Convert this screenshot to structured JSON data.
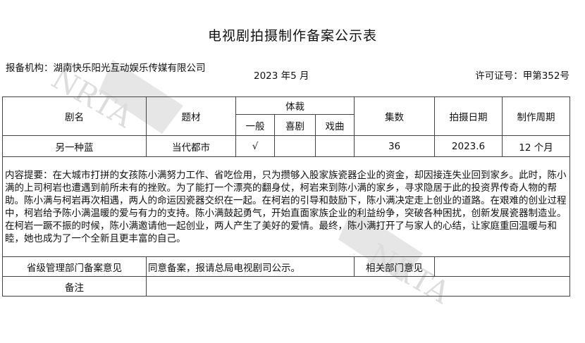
{
  "doc": {
    "title": "电视剧拍摄制作备案公示表",
    "org_label": "报备机构：",
    "org_name": "湖南快乐阳光互动娱乐传媒有限公司",
    "date": "2023 年5 月",
    "license_label": "许可证号：",
    "license_no": "甲第352号"
  },
  "table": {
    "headers": {
      "name": "剧名",
      "theme": "题材",
      "genre": "体裁",
      "genre_general": "一般",
      "genre_comedy": "喜剧",
      "genre_opera": "戏曲",
      "episodes": "集数",
      "shoot_date": "拍摄日期",
      "cycle": "制作周期"
    },
    "row": {
      "name": "另一种蓝",
      "theme": "当代都市",
      "general": "√",
      "comedy": "",
      "opera": "",
      "episodes": "36",
      "shoot_date": "2023.6",
      "cycle": "12 个月"
    },
    "content_label": "内容提要：",
    "content_text": "在大城市打拼的女孩陈小满努力工作、省吃俭用，只为攒够入股家族瓷器企业的资金，却因接连失业回到家乡。此时，陈小满的上司柯岩也遭遇到前所未有的挫败。为了能打一个漂亮的翻身仗，柯岩来到陈小满的家乡，寻求隐居于此的投资界传奇人物的帮助。陈小满与柯岩再次相遇，两人的命运因瓷器交织在一起。在柯岩的引导和鼓励下，陈小满决定走上创业的道路。在艰难的创业过程中，柯岩给予陈小满温暖的爱与有力的支持。陈小满鼓起勇气，开始直面家族企业的利益纷争，突破各种困扰，创新发展瓷器制造业。在柯岩一蹶不振的时候，陈小满邀请他一起创业，两人产生了美好的爱情。最终，陈小满打开了与家人的心结，让家庭重回温暖与和睦，她也成为了一个全新且更丰富的自己。",
    "provincial_label": "省级管理部门备案意见",
    "provincial_opinion": "同意备案，报请总局电视剧司公示。",
    "related_label": "相关部门意见",
    "related_opinion": "",
    "remarks_label": "备注",
    "remarks": ""
  },
  "watermark": {
    "text": "NRTA",
    "color": "#dcdcdc"
  }
}
